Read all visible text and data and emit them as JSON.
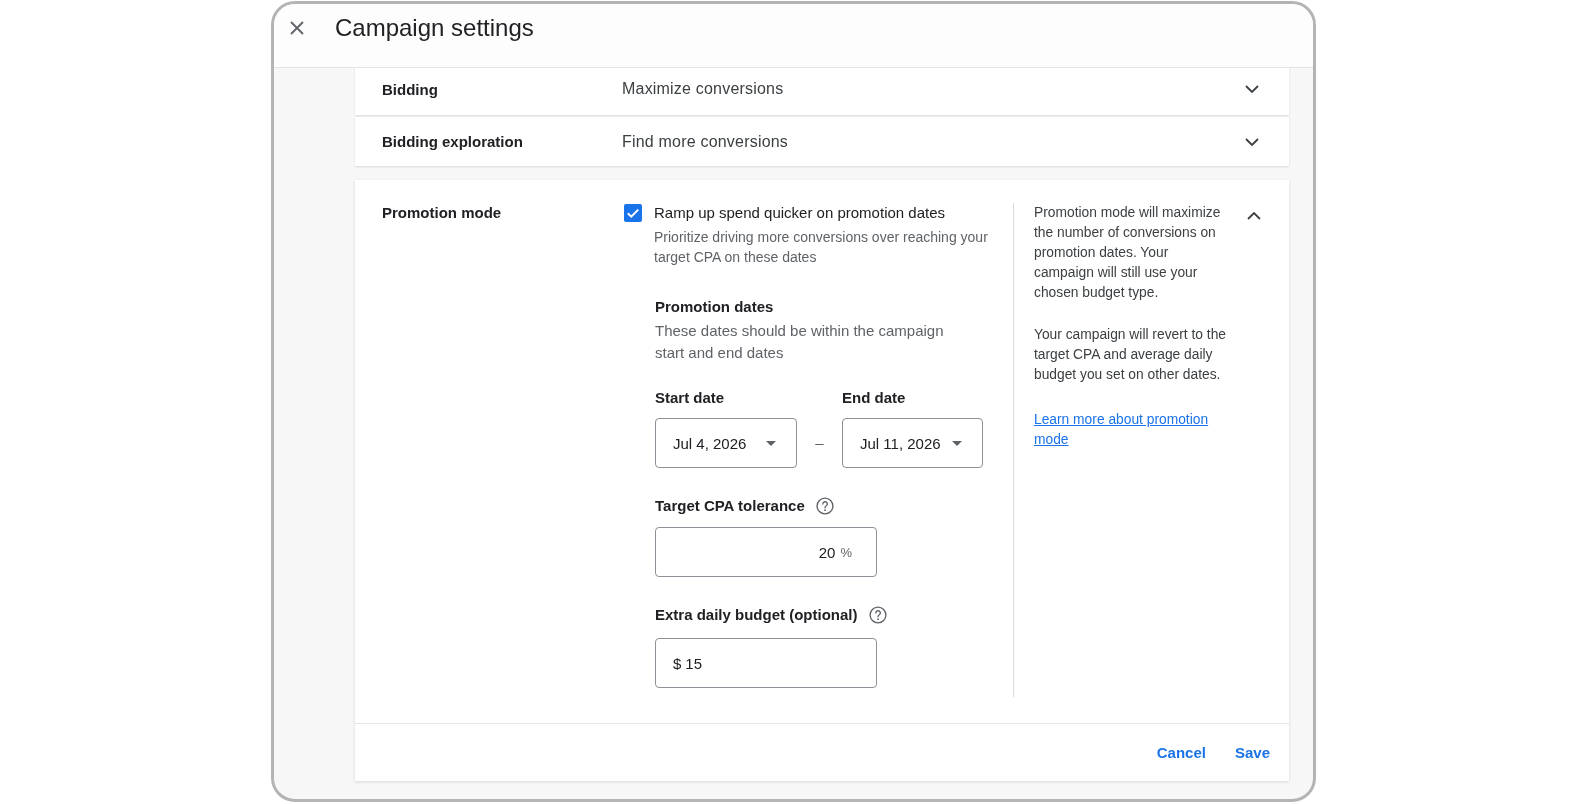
{
  "window": {
    "title": "Campaign settings"
  },
  "settings": [
    {
      "label": "Bidding",
      "value": "Maximize conversions",
      "expanded": false
    },
    {
      "label": "Bidding exploration",
      "value": "Find more conversions",
      "expanded": false
    }
  ],
  "promotion_mode": {
    "label": "Promotion mode",
    "expanded": true,
    "checkbox": {
      "label": "Ramp up spend quicker on promotion dates",
      "description": "Prioritize driving more conversions over reaching your target CPA on these dates",
      "checked": true
    },
    "dates": {
      "heading": "Promotion dates",
      "description": "These dates should be within the campaign start and end dates",
      "start": {
        "label": "Start date",
        "value": "Jul 4, 2026"
      },
      "separator": "–",
      "end": {
        "label": "End date",
        "value": "Jul 11, 2026"
      }
    },
    "tolerance": {
      "label": "Target CPA tolerance",
      "value": "20",
      "suffix": "%"
    },
    "extra_budget": {
      "label": "Extra daily budget (optional)",
      "prefix": "$",
      "value": "15"
    },
    "help": {
      "paragraphs": [
        "Promotion mode will maximize the number of conversions on promotion dates. Your campaign will still use your chosen budget type.",
        "Your campaign will revert to the target CPA and average daily budget you set on other dates."
      ],
      "link": "Learn more about promotion mode"
    },
    "actions": [
      "Cancel",
      "Save"
    ]
  }
}
